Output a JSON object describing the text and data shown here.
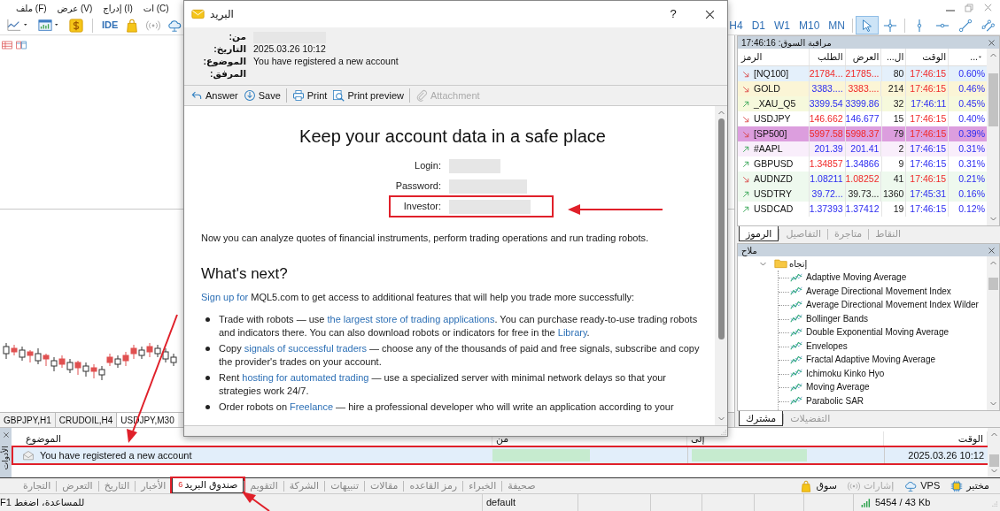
{
  "menu_items": [
    "ات (C)",
    "إدراج (I)",
    "عرض (V)",
    "ملف (F)"
  ],
  "toolbar": [
    {
      "kind": "line-chart",
      "dropdown": true
    },
    {
      "kind": "chart-window",
      "dropdown": true
    },
    {
      "kind": "dollar",
      "dropdown": false
    },
    {
      "kind": "ide",
      "label": "IDE",
      "dropdown": false
    },
    {
      "kind": "bag",
      "dropdown": false
    },
    {
      "kind": "signal",
      "dropdown": false
    },
    {
      "kind": "cloud",
      "dropdown": false
    }
  ],
  "timeframes": [
    "H4",
    "D1",
    "W1",
    "M10",
    "MN"
  ],
  "drawing_tools": [
    {
      "kind": "cursor",
      "selected": true
    },
    {
      "kind": "crosshair",
      "selected": false
    },
    {
      "kind": "vertical-line",
      "selected": false
    },
    {
      "kind": "horizontal-line",
      "selected": false
    },
    {
      "kind": "trend-line",
      "selected": false
    },
    {
      "kind": "channel",
      "selected": false
    }
  ],
  "chart_tabs": [
    {
      "label": "GBPJPY,H1",
      "selected": false
    },
    {
      "label": "CRUDOIL,H4",
      "selected": false
    },
    {
      "label": "USDJPY,M30",
      "selected": true
    }
  ],
  "market_watch": {
    "title": "مراقبة السوق: 17:46:16",
    "columns": [
      "...",
      "الوقت",
      "...ال",
      "العرض",
      "الطلب",
      "الرمز"
    ],
    "rows": [
      {
        "symbol": "[NQ100]",
        "rising": false,
        "color": "#e4f0fb",
        "bid": "21784...",
        "bid_up": false,
        "ask": "21785...",
        "ask_up": false,
        "spread": "80",
        "time": "17:46:15",
        "time_up": false,
        "change": "0.60%"
      },
      {
        "symbol": "GOLD",
        "rising": false,
        "color": "#fbf5d6",
        "bid": "3383....",
        "bid_up": true,
        "ask": "3383....",
        "ask_up": false,
        "spread": "214",
        "time": "17:46:15",
        "time_up": false,
        "change": "0.46%"
      },
      {
        "symbol": "_XAU_Q5",
        "rising": true,
        "color": "#f6f9dc",
        "bid": "3399.54",
        "bid_up": true,
        "ask": "3399.86",
        "ask_up": true,
        "spread": "32",
        "time": "17:46:11",
        "time_up": true,
        "change": "0.45%"
      },
      {
        "symbol": "USDJPY",
        "rising": false,
        "color": "#ffffff",
        "bid": "146.662",
        "bid_up": false,
        "ask": "146.677",
        "ask_up": true,
        "spread": "15",
        "time": "17:46:15",
        "time_up": false,
        "change": "0.40%"
      },
      {
        "symbol": "[SP500]",
        "rising": false,
        "color": "#dc9ede",
        "bid": "5997.58",
        "bid_up": false,
        "ask": "5998.37",
        "ask_up": false,
        "spread": "79",
        "time": "17:46:15",
        "time_up": false,
        "change": "0.39%"
      },
      {
        "symbol": "#AAPL",
        "rising": true,
        "color": "#f9eefb",
        "bid": "201.39",
        "bid_up": true,
        "ask": "201.41",
        "ask_up": true,
        "spread": "2",
        "time": "17:46:15",
        "time_up": true,
        "change": "0.31%"
      },
      {
        "symbol": "GBPUSD",
        "rising": true,
        "color": "#ffffff",
        "bid": "1.34857",
        "bid_up": false,
        "ask": "1.34866",
        "ask_up": true,
        "spread": "9",
        "time": "17:46:15",
        "time_up": true,
        "change": "0.31%"
      },
      {
        "symbol": "AUDNZD",
        "rising": false,
        "color": "#eef9ee",
        "bid": "1.08211",
        "bid_up": true,
        "ask": "1.08252",
        "ask_up": false,
        "spread": "41",
        "time": "17:46:15",
        "time_up": false,
        "change": "0.21%"
      },
      {
        "symbol": "USDTRY",
        "rising": true,
        "color": "#eef9ee",
        "bid": "39.72...",
        "bid_up": true,
        "ask": "39.73...",
        "spread": "1360",
        "time": "17:45:31",
        "time_up": true,
        "change": "0.16%"
      },
      {
        "symbol": "USDCAD",
        "rising": true,
        "color": "#ffffff",
        "bid": "1.37393",
        "bid_up": true,
        "ask": "1.37412",
        "ask_up": true,
        "spread": "19",
        "time": "17:46:15",
        "time_up": true,
        "change": "0.12%"
      }
    ],
    "tabs": [
      {
        "label": "النقاط",
        "selected": false
      },
      {
        "label": "متاجرة",
        "selected": false
      },
      {
        "label": "التفاصيل",
        "selected": false
      },
      {
        "label": "الرموز",
        "selected": true
      }
    ]
  },
  "navigator": {
    "title": "ملاح",
    "folder": {
      "label": "إتجاه",
      "expanded": true,
      "children": [
        {
          "label": "Adaptive Moving Average"
        },
        {
          "label": "Average Directional Movement Index"
        },
        {
          "label": "Average Directional Movement Index Wilder"
        },
        {
          "label": "Bollinger Bands"
        },
        {
          "label": "Double Exponential Moving Average"
        },
        {
          "label": "Envelopes"
        },
        {
          "label": "Fractal Adaptive Moving Average"
        },
        {
          "label": "Ichimoku Kinko Hyo"
        },
        {
          "label": "Moving Average"
        },
        {
          "label": "Parabolic SAR"
        }
      ]
    },
    "tabs": [
      {
        "label": "التفضيلات",
        "selected": false
      },
      {
        "label": "مشترك",
        "selected": true
      }
    ]
  },
  "mail_window": {
    "title": "البريد",
    "help": "?",
    "fields": [
      {
        "label": "من:",
        "redacted": true
      },
      {
        "label": "التاريخ:",
        "value": "2025.03.26 10:12"
      },
      {
        "label": "الموضوع:",
        "value": "You have registered a new account"
      },
      {
        "label": "المرفق:"
      }
    ],
    "actions": [
      {
        "kind": "reply",
        "label": "Answer",
        "disabled": false
      },
      {
        "kind": "save",
        "label": "Save",
        "disabled": false
      },
      {
        "kind": "print",
        "label": "Print",
        "disabled": false
      },
      {
        "kind": "preview",
        "label": "Print preview",
        "disabled": false
      },
      {
        "kind": "attachment",
        "label": "Attachment",
        "disabled": true
      }
    ],
    "message": {
      "heading": "Keep your account data in a safe place",
      "credentials": [
        {
          "label": "Login:",
          "redacted": true,
          "highlighted": false
        },
        {
          "label": "Password:",
          "redacted": true,
          "highlighted": false
        },
        {
          "label": "Investor:",
          "redacted": true,
          "highlighted": true
        }
      ],
      "intro": "Now you can analyze quotes of financial instruments, perform trading operations and run trading robots.",
      "subheading": "What's next?",
      "signup": [
        {
          "text": "Sign up for",
          "link": true
        },
        {
          "text": " MQL5.com to get access to additional features that will help you trade more successfully:",
          "link": false
        }
      ],
      "bullets": [
        [
          {
            "text": "Trade with robots — use ",
            "link": false
          },
          {
            "text": "the largest store of trading applications",
            "link": true
          },
          {
            "text": ". You can purchase ready-to-use trading robots and indicators there. You can also download robots or indicators for free in the ",
            "link": false
          },
          {
            "text": "Library",
            "link": true
          },
          {
            "text": ".",
            "link": false
          }
        ],
        [
          {
            "text": "Copy ",
            "link": false
          },
          {
            "text": "signals of successful traders",
            "link": true
          },
          {
            "text": " — choose any of the thousands of paid and free signals, subscribe and copy the provider's trades on your account.",
            "link": false
          }
        ],
        [
          {
            "text": "Rent ",
            "link": false
          },
          {
            "text": "hosting for automated trading",
            "link": true
          },
          {
            "text": " — use a specialized server with minimal network delays so that your strategies work 24/7.",
            "link": false
          }
        ],
        [
          {
            "text": "Order robots on ",
            "link": false
          },
          {
            "text": "Freelance",
            "link": true
          },
          {
            "text": " — hire a professional developer who will write an application according to your",
            "link": false
          }
        ]
      ]
    }
  },
  "toolbox": {
    "title": "الأدوات",
    "columns": [
      "الوقت",
      "إلى",
      "من",
      "الموضوع"
    ],
    "rows": [
      {
        "subject": "You have registered a new account",
        "time": "2025.03.26 10:12",
        "selected": true,
        "highlighted": true
      }
    ],
    "tabs": [
      {
        "label": "صحيفة",
        "selected": false
      },
      {
        "label": "الخبراء",
        "selected": false
      },
      {
        "label": "رمز القاعده",
        "selected": false
      },
      {
        "label": "مقالات",
        "selected": false
      },
      {
        "label": "تنبيهات",
        "selected": false
      },
      {
        "label": "الشركة",
        "selected": false
      },
      {
        "label": "التقويم",
        "selected": false
      },
      {
        "label": "صندوق البريد",
        "count": "6",
        "selected": true,
        "highlighted": true
      },
      {
        "label": "الأخبار",
        "selected": false
      },
      {
        "label": "التاريخ",
        "selected": false
      },
      {
        "label": "التعرض",
        "selected": false
      },
      {
        "label": "التجارة",
        "selected": false
      }
    ],
    "services": [
      {
        "kind": "chip",
        "label": "مختبر",
        "disabled": false
      },
      {
        "kind": "cloud",
        "label": "VPS",
        "disabled": false
      },
      {
        "kind": "signal",
        "label": "إشارات",
        "disabled": true
      },
      {
        "kind": "bag",
        "label": "سوق",
        "disabled": false
      }
    ]
  },
  "status_bar": {
    "help": "للمساعدة، اضغط F1",
    "profile": "default",
    "traffic": "5454 / 43 Kb"
  }
}
